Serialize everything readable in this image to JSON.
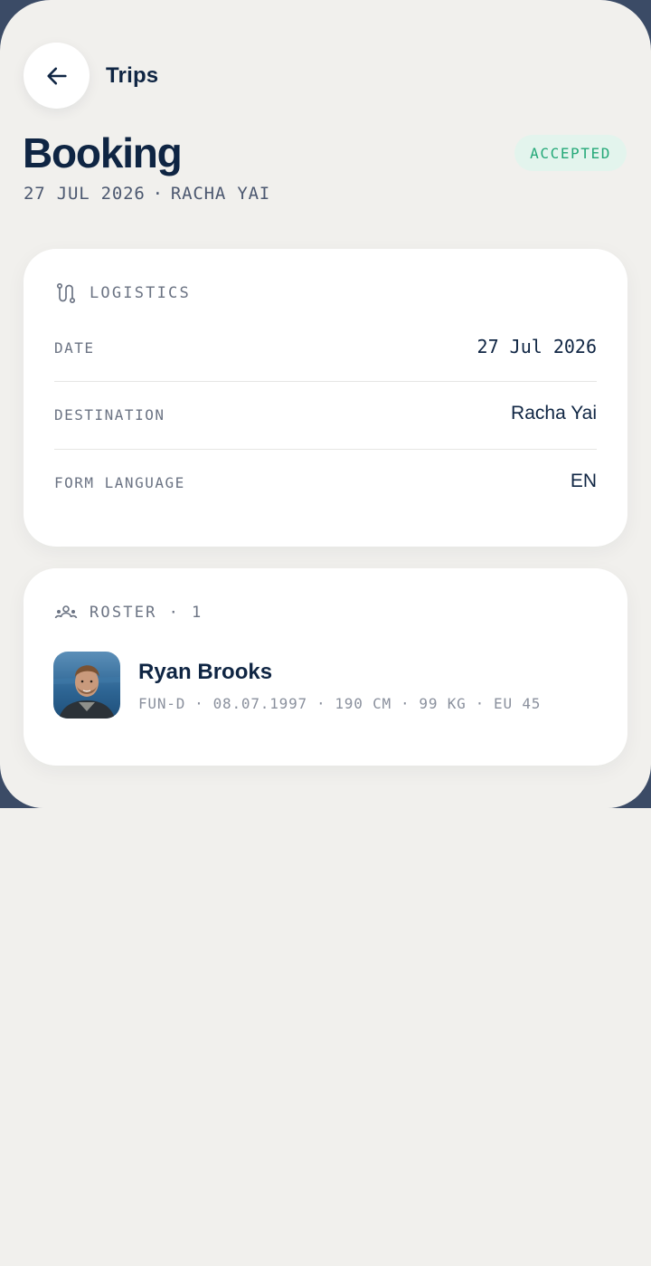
{
  "header": {
    "back_label": "Trips",
    "title": "Booking",
    "subtitle_date": "27 JUL 2026",
    "subtitle_separator": "·",
    "subtitle_destination": "RACHA YAI",
    "status": "ACCEPTED",
    "status_color": "#24a878"
  },
  "logistics": {
    "heading": "LOGISTICS",
    "icon": "route-icon",
    "rows": [
      {
        "label": "DATE",
        "value": "27 Jul 2026"
      },
      {
        "label": "DESTINATION",
        "value": "Racha Yai"
      },
      {
        "label": "FORM LANGUAGE",
        "value": "EN"
      }
    ]
  },
  "roster": {
    "heading": "ROSTER",
    "separator": "·",
    "count": "1",
    "icon": "group-icon",
    "people": [
      {
        "name": "Ryan Brooks",
        "meta": [
          "FUN-D",
          "08.07.1997",
          "190 CM",
          "99 KG",
          "EU 45"
        ],
        "meta_separator": "·"
      }
    ]
  },
  "colors": {
    "background": "#f1f0ed",
    "navy": "#0f2543",
    "frame": "#3b4b66",
    "accent_green": "#24a878"
  }
}
